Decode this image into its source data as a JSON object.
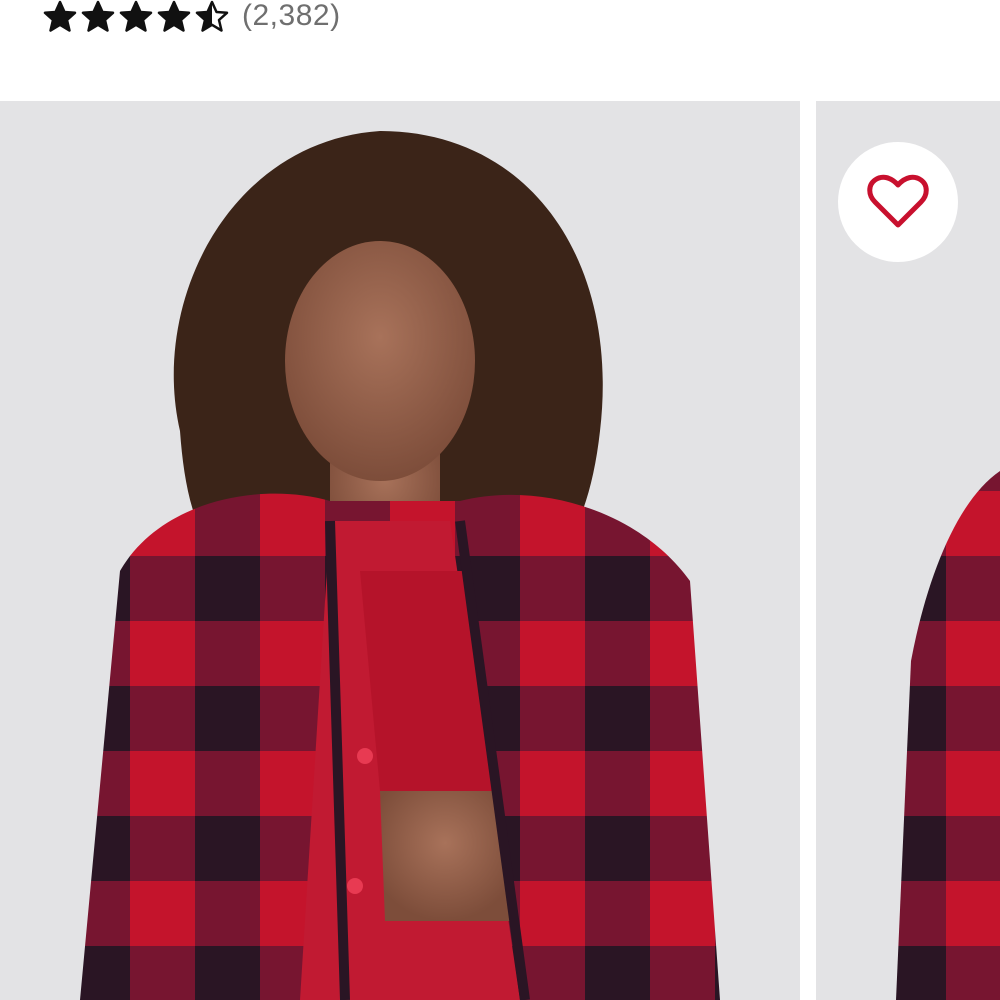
{
  "product": {
    "rating": {
      "stars_value": 4.5,
      "stars_max": 5,
      "review_count_text": "(2,382)"
    }
  },
  "gallery": {
    "images": [
      {
        "alt_icon": "model-photo-front"
      },
      {
        "alt_icon": "model-photo-side"
      }
    ],
    "favorite_icon": "heart-outline-icon"
  },
  "colors": {
    "star": "#111111",
    "count_text": "#6f6f6f",
    "photo_bg": "#e3e3e5",
    "heart": "#c8102e",
    "plaid_red": "#c4142c",
    "plaid_dark": "#2a1524"
  }
}
